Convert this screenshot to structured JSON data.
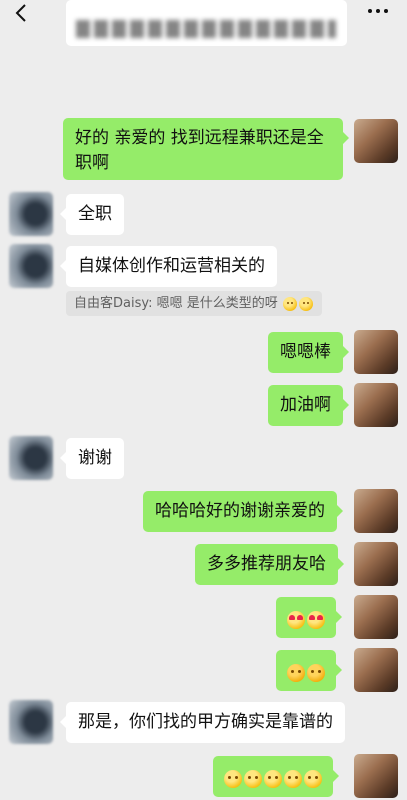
{
  "header": {
    "back_icon": "chevron-left-icon",
    "more_icon": "more-dots-icon"
  },
  "messages": [
    {
      "side": "out",
      "text": "好的 亲爱的 找到远程兼职还是全职啊"
    },
    {
      "side": "in",
      "text": "全职"
    },
    {
      "side": "in",
      "text": "自媒体创作和运营相关的"
    },
    {
      "side": "out",
      "text": "嗯嗯棒"
    },
    {
      "side": "out",
      "text": "加油啊"
    },
    {
      "side": "in",
      "text": "谢谢"
    },
    {
      "side": "out",
      "text": "哈哈哈好的谢谢亲爱的"
    },
    {
      "side": "out",
      "text": "多多推荐朋友哈"
    },
    {
      "side": "in",
      "text": "那是，你们找的甲方确实是靠谱的"
    }
  ],
  "quote": {
    "sender": "自由客Daisy:",
    "text": "嗯嗯 是什么类型的呀"
  },
  "emoji_messages": [
    {
      "emoji": "heart-eyes-icon",
      "count": 2
    },
    {
      "emoji": "shy-face-icon",
      "count": 2
    },
    {
      "emoji": "smirk-face-icon",
      "count": 5
    }
  ],
  "colors": {
    "background": "#ededed",
    "incoming_bubble": "#ffffff",
    "outgoing_bubble": "#95ec69"
  }
}
